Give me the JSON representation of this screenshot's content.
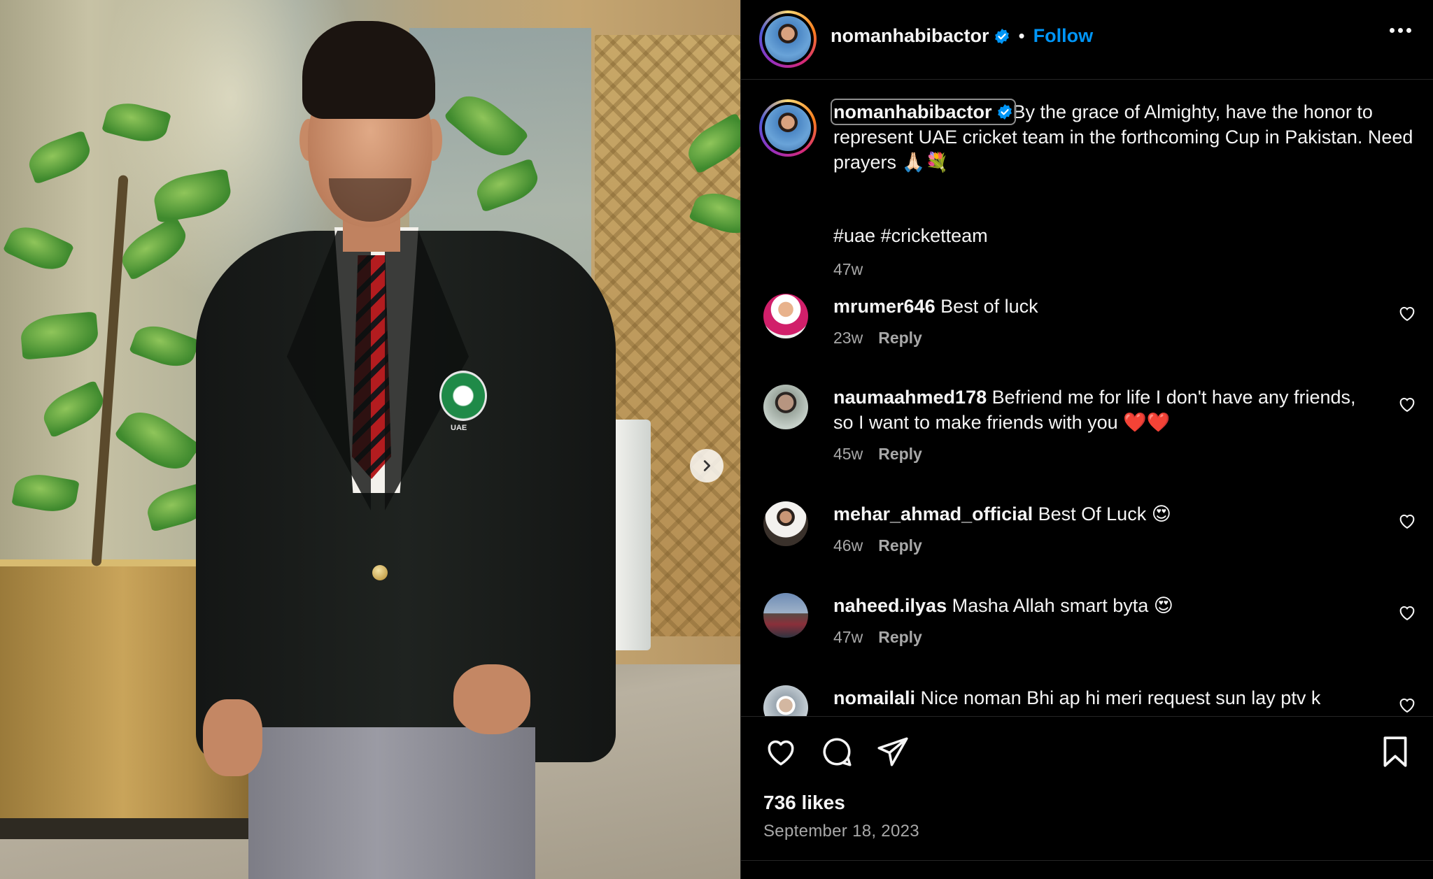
{
  "post": {
    "username": "nomanhabibactor",
    "follow_label": "Follow",
    "dot": "•",
    "caption": "By the grace of Almighty, have the honor to represent UAE cricket team in the forthcoming Cup in Pakistan. Need prayers 🙏🏻💐",
    "hashtags": "#uae #cricketteam",
    "caption_time": "47w",
    "likes": "736 likes",
    "date": "September 18, 2023",
    "badge_text": "UAE"
  },
  "reply_label": "Reply",
  "comments": [
    {
      "username": "mrumer646",
      "text": "Best of luck",
      "time": "23w"
    },
    {
      "username": "naumaahmed178",
      "text": "Befriend me for life I don't have any friends, so I want to make friends with you ❤️❤️",
      "time": "45w"
    },
    {
      "username": "mehar_ahmad_official",
      "text": "Best Of Luck 😍",
      "time": "46w"
    },
    {
      "username": "naheed.ilyas",
      "text": "Masha Allah smart byta 😍",
      "time": "47w"
    },
    {
      "username": "nomailali",
      "text": "Nice noman Bhi ap hi meri request sun lay ptv k",
      "time": ""
    }
  ],
  "colors": {
    "background": "#000000",
    "text": "#f5f5f5",
    "muted": "#a8a8a8",
    "follow_blue": "#0095f6",
    "verified_blue": "#0095f6"
  },
  "icons": [
    "more-options-icon",
    "verified-icon",
    "heart-icon",
    "comment-icon",
    "share-icon",
    "bookmark-icon",
    "chevron-right-icon"
  ]
}
